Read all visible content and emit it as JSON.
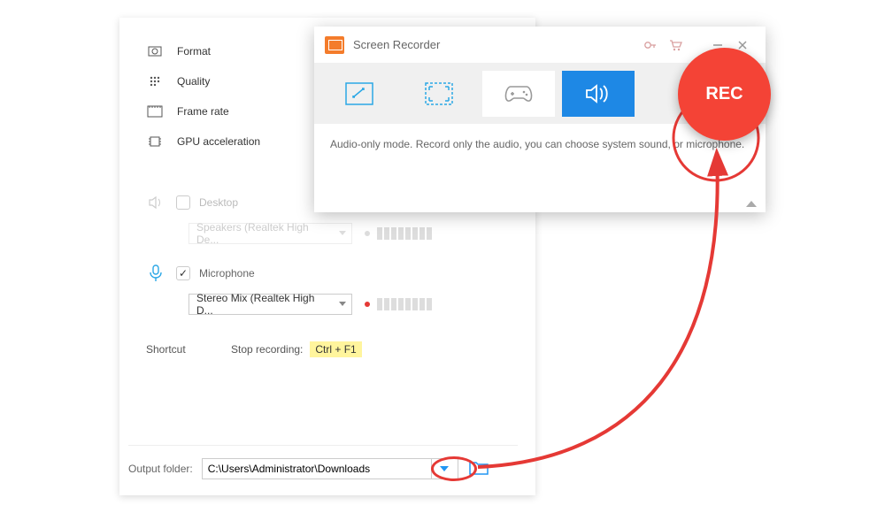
{
  "settings": {
    "items": [
      {
        "label": "Format"
      },
      {
        "label": "Quality"
      },
      {
        "label": "Frame rate"
      },
      {
        "label": "GPU acceleration"
      }
    ]
  },
  "audio": {
    "desktop": {
      "label": "Desktop",
      "device": "Speakers (Realtek High De...",
      "enabled": false
    },
    "microphone": {
      "label": "Microphone",
      "device": "Stereo Mix (Realtek High D...",
      "enabled": true
    }
  },
  "shortcut": {
    "label": "Shortcut",
    "sublabel": "Stop recording:",
    "key": "Ctrl + F1"
  },
  "output": {
    "label": "Output folder:",
    "path": "C:\\Users\\Administrator\\Downloads"
  },
  "recorder": {
    "title": "Screen Recorder",
    "rec_label": "REC",
    "description": "Audio-only mode. Record only the audio, you can choose system sound, or microphone."
  }
}
